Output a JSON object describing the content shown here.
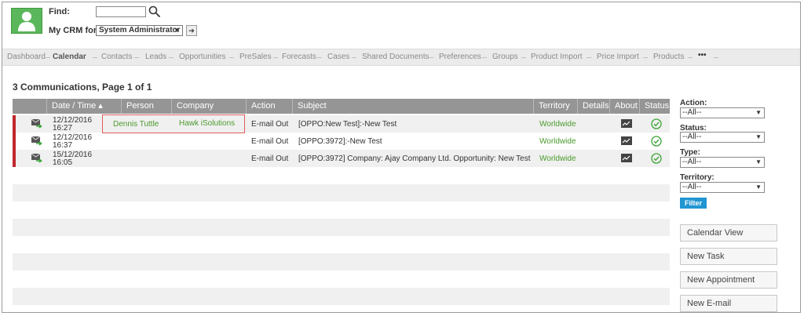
{
  "header": {
    "find_label": "Find:",
    "find_value": "",
    "mycrm_label": "My CRM for:",
    "user_select": "System Administrator"
  },
  "nav": [
    {
      "label": "Dashboard",
      "active": false
    },
    {
      "label": "Calendar",
      "active": true
    },
    {
      "label": "Contacts",
      "active": false
    },
    {
      "label": "Leads",
      "active": false
    },
    {
      "label": "Opportunities",
      "active": false
    },
    {
      "label": "PreSales",
      "active": false
    },
    {
      "label": "Forecasts",
      "active": false
    },
    {
      "label": "Cases",
      "active": false
    },
    {
      "label": "Shared Documents",
      "active": false
    },
    {
      "label": "Preferences",
      "active": false
    },
    {
      "label": "Groups",
      "active": false
    },
    {
      "label": "Product Import",
      "active": false
    },
    {
      "label": "Price Import",
      "active": false
    },
    {
      "label": "Products",
      "active": false
    },
    {
      "label": "•••",
      "active": false
    }
  ],
  "page_title": "3 Communications, Page 1 of 1",
  "table": {
    "columns": [
      "Date / Time ▴",
      "Person",
      "Company",
      "Action",
      "Subject",
      "Territory",
      "Details",
      "About",
      "Status"
    ],
    "rows": [
      {
        "date": "12/12/2016",
        "time": "16:27",
        "person": "Dennis Tuttle",
        "company": "Hawk iSolutions",
        "action": "E-mail Out",
        "subject": "[OPPO:New Test]:-New Test",
        "territory": "Worldwide"
      },
      {
        "date": "12/12/2016",
        "time": "16:37",
        "person": "",
        "company": "",
        "action": "E-mail Out",
        "subject": "[OPPO:3972]:-New Test",
        "territory": "Worldwide"
      },
      {
        "date": "15/12/2016",
        "time": "16:05",
        "person": "",
        "company": "",
        "action": "E-mail Out",
        "subject": "[OPPO:3972] Company: Ajay Company Ltd. Opportunity: New Test",
        "territory": "Worldwide"
      }
    ]
  },
  "filters": {
    "action_label": "Action:",
    "action_value": "--All--",
    "status_label": "Status:",
    "status_value": "--All--",
    "type_label": "Type:",
    "type_value": "--All--",
    "territory_label": "Territory:",
    "territory_value": "--All--",
    "filter_button": "Filter"
  },
  "side_buttons": {
    "calendar_view": "Calendar View",
    "new_task": "New Task",
    "new_appointment": "New Appointment",
    "new_email": "New E-mail"
  },
  "colors": {
    "accent_green": "#4a9a2c",
    "header_gray": "#959595",
    "row_marker_red": "#c0282c",
    "filter_blue": "#2196d3"
  }
}
